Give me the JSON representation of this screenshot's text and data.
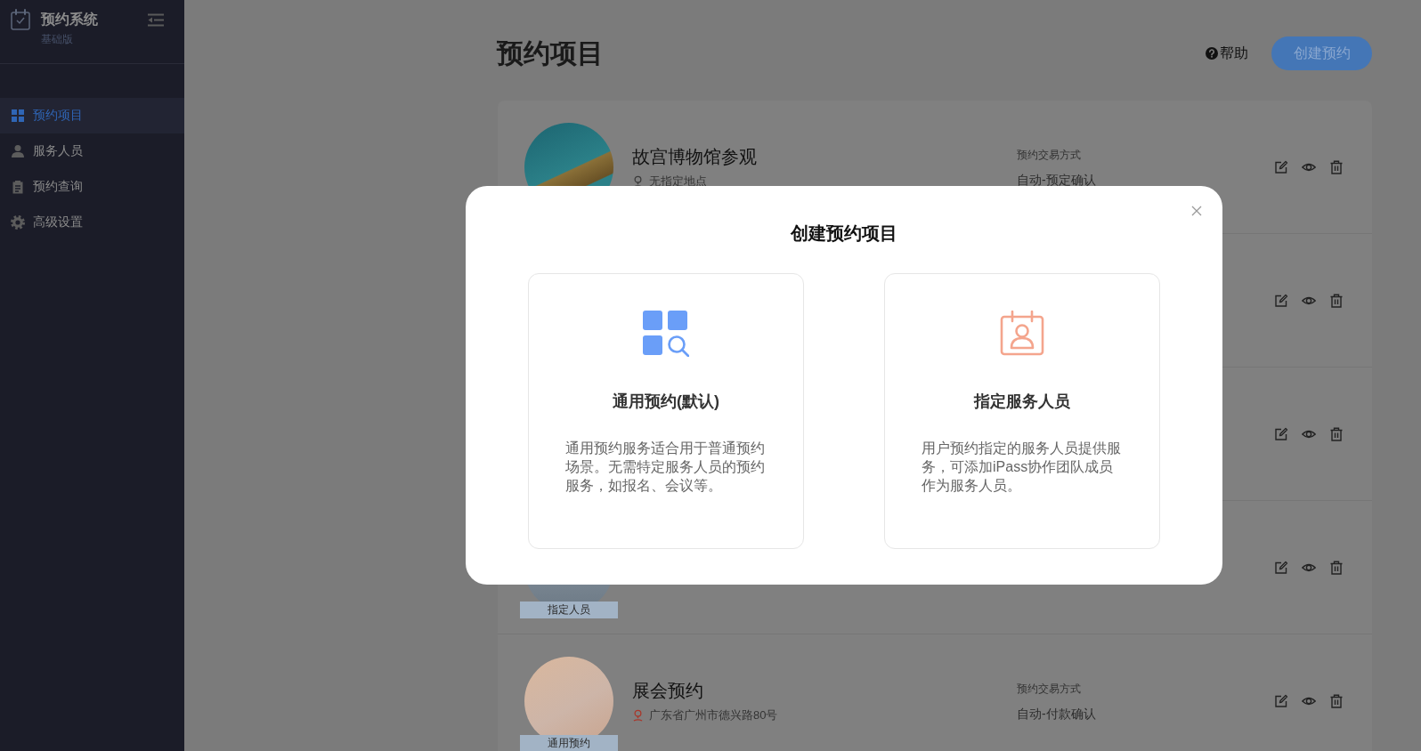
{
  "sidebar": {
    "app_name": "预约系统",
    "edition": "基础版",
    "menu": [
      {
        "label": "预约项目",
        "selected": true
      },
      {
        "label": "服务人员",
        "selected": false
      },
      {
        "label": "预约查询",
        "selected": false
      },
      {
        "label": "高级设置",
        "selected": false
      }
    ]
  },
  "header": {
    "title": "预约项目",
    "help": "帮助",
    "create_button": "创建预约"
  },
  "projects": [
    {
      "kind": "project",
      "photo": true,
      "title": "故宫博物馆参观",
      "location": {
        "text": "无指定地点",
        "color": "#3a3a3a"
      },
      "trade_label": "预约交易方式",
      "trade_value": "自动-预定确认"
    },
    {
      "kind": "project"
    },
    {
      "kind": "project"
    },
    {
      "kind": "project",
      "photo": true,
      "badge": "指定人员"
    },
    {
      "kind": "project",
      "photo": true,
      "title": "展会预约",
      "badge": "通用预约",
      "location": {
        "text": "广东省广州市德兴路80号",
        "color": "#a8372b"
      },
      "trade_label": "预约交易方式",
      "trade_value": "自动-付款确认"
    }
  ],
  "dialog": {
    "title": "创建预约项目",
    "options": [
      {
        "kind": "general",
        "title": "通用预约(默认)",
        "description": "通用预约服务适合用于普通预约场景。无需特定服务人员的预约服务，如报名、会议等。"
      },
      {
        "kind": "staff",
        "title": "指定服务人员",
        "description": "用户预约指定的服务人员提供服务，可添加iPass协作团队成员作为服务人员。"
      }
    ]
  }
}
